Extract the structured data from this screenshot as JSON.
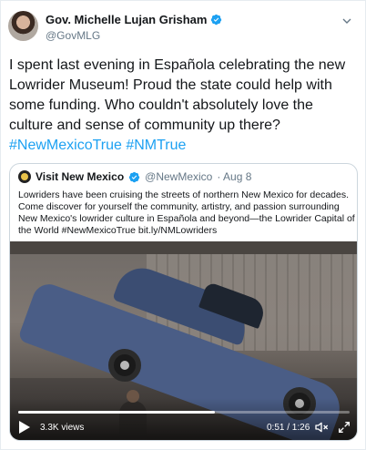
{
  "tweet": {
    "author": {
      "name": "Gov. Michelle Lujan Grisham",
      "handle": "@GovMLG"
    },
    "text_parts": [
      "I spent last evening in Española celebrating the new Lowrider Museum! Proud the state could help with some funding. Who couldn't absolutely love the culture and sense of community up there? ",
      "#NewMexicoTrue",
      " ",
      "#NMTrue"
    ]
  },
  "quoted": {
    "name": "Visit New Mexico",
    "handle": "@NewMexico",
    "date": "· Aug 8",
    "text": "Lowriders have been cruising the streets of northern New Mexico for decades. Come discover for yourself the community, artistry, and passion surrounding New Mexico's lowrider culture in Española and beyond—the Lowrider Capital of the World #NewMexicoTrue bit.ly/NMLowriders",
    "video": {
      "views": "3.3K views",
      "time": "0:51 / 1:26",
      "progress": 0.593
    }
  },
  "colors": {
    "accent": "#1da1f2",
    "text": "#14171a",
    "secondary": "#657786",
    "border": "#ccd6dd"
  },
  "icons": [
    "verified-badge-icon",
    "chevron-down-icon",
    "play-icon",
    "mute-icon",
    "fullscreen-icon"
  ]
}
